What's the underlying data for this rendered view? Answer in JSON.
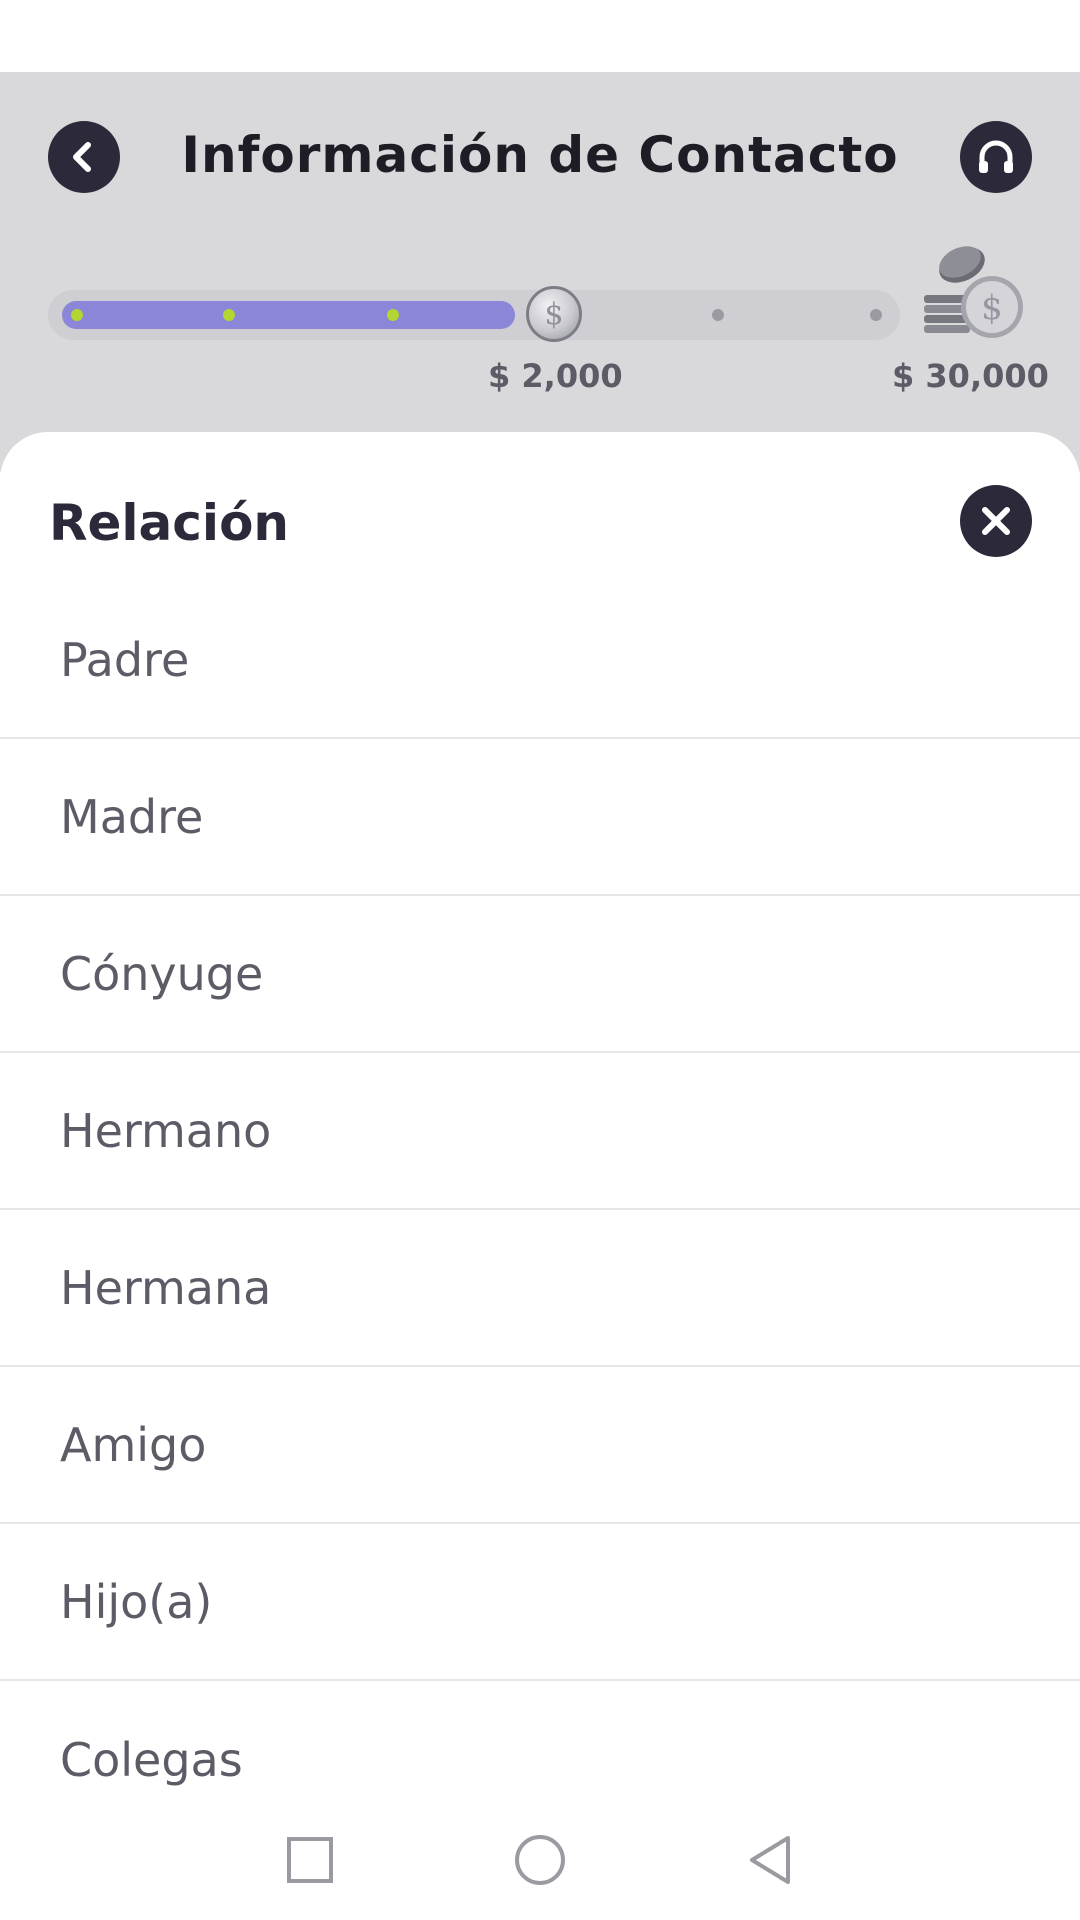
{
  "header": {
    "title": "Información de Contacto",
    "progress": {
      "fraction": 0.55,
      "steps_total": 6,
      "steps_completed": 3,
      "current_amount": "$ 2,000",
      "max_amount": "$ 30,000"
    }
  },
  "sheet": {
    "title": "Relación",
    "options": [
      {
        "label": "Padre"
      },
      {
        "label": "Madre"
      },
      {
        "label": "Cónyuge"
      },
      {
        "label": "Hermano"
      },
      {
        "label": "Hermana"
      },
      {
        "label": "Amigo"
      },
      {
        "label": "Hijo(a)"
      },
      {
        "label": "Colegas"
      }
    ]
  },
  "icons": {
    "back": "chevron-left-icon",
    "support": "headset-icon",
    "close": "close-icon",
    "coin": "dollar-coin-icon",
    "coin_stack": "coin-stack-icon",
    "nav_recents": "square-icon",
    "nav_home": "circle-icon",
    "nav_back": "triangle-back-icon"
  },
  "colors": {
    "accent": "#8b86d8",
    "completed_dot": "#b3d633",
    "dark": "#2c2a3a",
    "header_bg": "#d9d9dc"
  }
}
